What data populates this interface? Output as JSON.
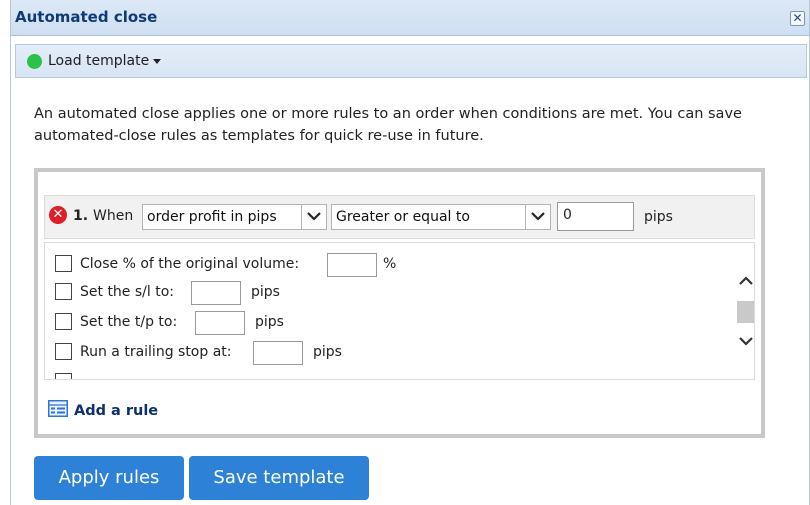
{
  "dialog": {
    "title": "Automated close",
    "close_symbol": "✕"
  },
  "toolbar": {
    "status_color": "#2cc24a",
    "load_template_label": "Load template"
  },
  "description": "An automated close applies one or more rules to an order when conditions are met. You can save automated-close rules as templates for quick re-use in future.",
  "rule": {
    "number": "1.",
    "when_label": "When",
    "condition_value": "order profit in pips",
    "operator_value": "Greater or equal to",
    "threshold_value": "0",
    "unit": "pips"
  },
  "actions": [
    {
      "label": "Close % of the original volume:",
      "unit": "%"
    },
    {
      "label": "Set the s/l to:",
      "unit": "pips"
    },
    {
      "label": "Set the t/p to:",
      "unit": "pips"
    },
    {
      "label": "Run a trailing stop at:",
      "unit": "pips"
    }
  ],
  "add_rule_label": "Add a rule",
  "buttons": {
    "apply": "Apply rules",
    "save_template": "Save template"
  },
  "colors": {
    "accent": "#2d82d8",
    "title": "#0f3a78",
    "remove": "#dd1f2a"
  }
}
